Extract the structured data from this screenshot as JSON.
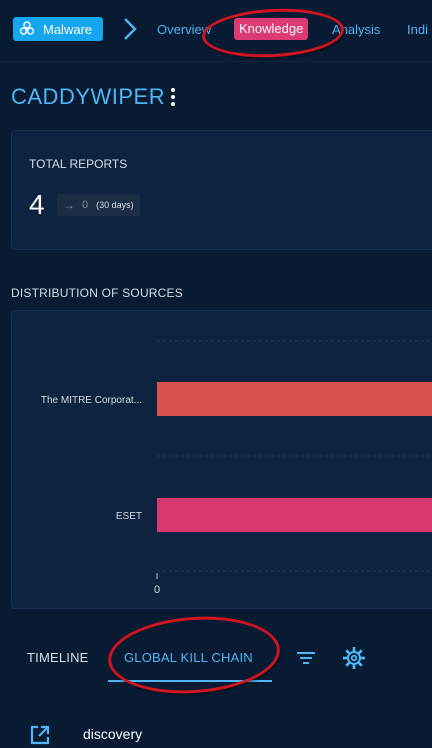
{
  "nav": {
    "entity_type": "Malware",
    "entity_icon": "biohazard-icon",
    "separator_icon": "chevron-right-icon",
    "tabs": [
      {
        "label": "Overview",
        "active": false
      },
      {
        "label": "Knowledge",
        "active": true
      },
      {
        "label": "Analysis",
        "active": false
      },
      {
        "label": "Indi",
        "active": false
      }
    ]
  },
  "entity": {
    "name": "CADDYWIPER",
    "menu_icon": "more-vertical-icon"
  },
  "reports": {
    "label": "TOTAL REPORTS",
    "value": "4",
    "delta_icon": "arrow-right-icon",
    "delta": "0",
    "delta_period": "(30 days)"
  },
  "distribution": {
    "label": "DISTRIBUTION OF SOURCES"
  },
  "chart_data": {
    "type": "bar",
    "orientation": "horizontal",
    "categories": [
      "The MITRE Corporat...",
      "ESET"
    ],
    "series": [
      {
        "values": [
          1,
          1
        ]
      }
    ],
    "bar_colors": [
      "#d9514e",
      "#d7396f"
    ],
    "x_ticks": [
      "0"
    ],
    "xlim": [
      0,
      1
    ],
    "grid": true
  },
  "bottom_tabs": {
    "timeline": "TIMELINE",
    "kill_chain": "GLOBAL KILL CHAIN",
    "active": "GLOBAL KILL CHAIN",
    "filter_icon": "filter-list-icon",
    "settings_icon": "settings-gear-icon"
  },
  "kill_chain": {
    "phases": [
      {
        "label": "discovery",
        "icon": "open-in-new-icon"
      }
    ]
  },
  "colors": {
    "background": "#081b33",
    "card": "#0e2340",
    "accent_blue": "#4fb5f5",
    "active_tab": "#dc3a73",
    "chip": "#15a6f0",
    "annotation": "#d01420"
  }
}
